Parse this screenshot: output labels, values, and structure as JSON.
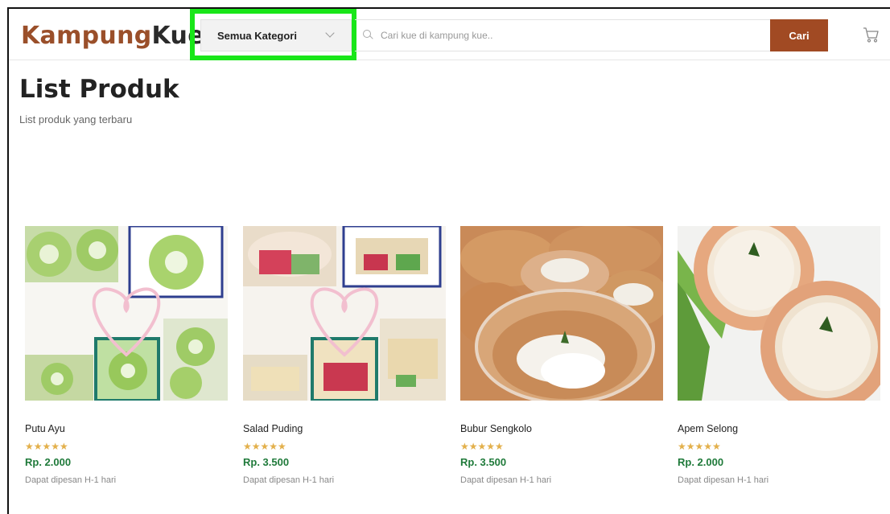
{
  "header": {
    "logo_part1": "Kampung",
    "logo_part2": "Kue",
    "category_label": "Semua Kategori",
    "search_placeholder": "Cari kue di kampung kue..",
    "search_button": "Cari"
  },
  "page": {
    "title": "List Produk",
    "subtitle": "List produk yang terbaru"
  },
  "products": [
    {
      "name": "Putu Ayu",
      "stars": "★★★★★",
      "price": "Rp. 2.000",
      "note": "Dapat dipesan H-1 hari"
    },
    {
      "name": "Salad Puding",
      "stars": "★★★★★",
      "price": "Rp. 3.500",
      "note": "Dapat dipesan H-1 hari"
    },
    {
      "name": "Bubur Sengkolo",
      "stars": "★★★★★",
      "price": "Rp. 3.500",
      "note": "Dapat dipesan H-1 hari"
    },
    {
      "name": "Apem Selong",
      "stars": "★★★★★",
      "price": "Rp. 2.000",
      "note": "Dapat dipesan H-1 hari"
    }
  ],
  "colors": {
    "brand": "#9a4f2a",
    "button": "#a14a23",
    "price": "#1f7a3a",
    "stars": "#e3b04b",
    "highlight": "#19e619"
  }
}
